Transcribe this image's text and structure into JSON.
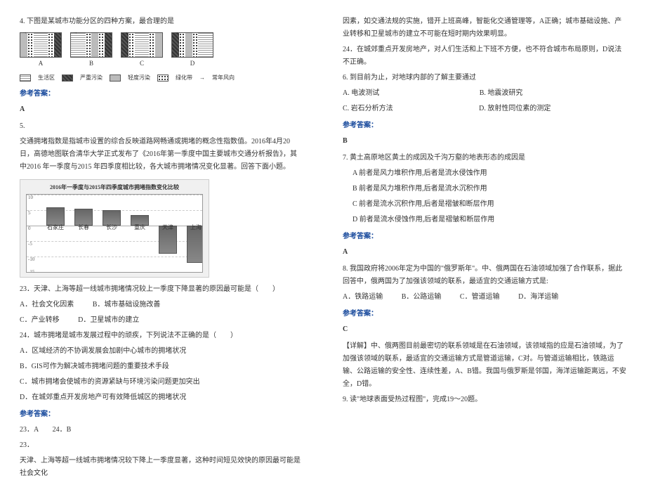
{
  "left": {
    "q4": {
      "prompt": "4. 下图是某城市功能分区的四种方案，最合理的是",
      "diagram_labels": [
        "A",
        "B",
        "C",
        "D"
      ],
      "legend": {
        "life": "生活区",
        "heavy": "严重污染",
        "light": "轻度污染",
        "green": "绿化带",
        "wind_arrow": "→",
        "wind": "常年风向"
      },
      "ans_label": "参考答案：",
      "answer": "A"
    },
    "q5": {
      "num": "5.",
      "context": "交通拥堵指数是指城市设置的综合反映道路网畅通或拥堵的概念性指数值。2016年4月20日，高德地图联合清华大学正式发布了《2016年第一季度中国主要城市交通分析报告》，其中2016 年一季度与2015 年四季度相比较，各大城市拥堵情况变化显著。回答下面小题。",
      "q23": "23．天津、上海等超一线城市拥堵情况较上一季度下降显著的原因最可能是（　　）",
      "q23_opts": {
        "A": "A．社会文化因素",
        "B": "B．城市基础设施改善",
        "C": "C．产业转移",
        "D": "D．卫星城市的建立"
      },
      "q24": "24．城市拥堵是城市发展过程中的顽疾，下列说法不正确的是（　　）",
      "q24_opts": {
        "A": "A．区域经济的不协调发展会加剧中心城市的拥堵状况",
        "B": "B．GIS可作为解决城市拥堵问题的重要技术手段",
        "C": "C．城市拥堵会使城市的资源紧缺与环境污染问题更加突出",
        "D": "D．在城郊重点开发房地产可有效降低城区的拥堵状况"
      },
      "ans_label": "参考答案：",
      "answer_line": "23．A　　24．B",
      "exp_num": "23．",
      "explanation": "天津、上海等超一线城市拥堵情况较下降上一季度显著，这种时间短见效快的原因最可能是社会文化"
    }
  },
  "right": {
    "q5_cont": {
      "line1": "因素，如交通法规的实施，错开上班高峰，智能化交通管理等，A正确；城市基础设施、产业转移和卫星城市的建立不可能在短时期内效果明显。",
      "line2": "24．在城郊重点开发房地产，对人们生活和上下班不方便，也不符合城市布局原则，D说法不正确。"
    },
    "q6": {
      "prompt": "6. 到目前为止，对地球内部的了解主要通过",
      "opts": {
        "A": "A. 电波测试",
        "B": "B. 地震波研究",
        "C": "C. 岩石分析方法",
        "D": "D. 放射性同位素的测定"
      },
      "ans_label": "参考答案：",
      "answer": "B"
    },
    "q7": {
      "prompt": "7. 黄土高原地区黄土的成因及千沟万壑的地表形态的成因是",
      "opts": {
        "A": "A 前者是风力堆积作用,后者是流水侵蚀作用",
        "B": "B 前者是风力堆积作用,后者是流水沉积作用",
        "C": "C 前者是流水沉积作用,后者是褶皱和断层作用",
        "D": "D 前者是流水侵蚀作用,后者是褶皱和断层作用"
      },
      "ans_label": "参考答案：",
      "answer": "A"
    },
    "q8": {
      "prompt": "8. 我国政府将2006年定为中国的\"俄罗斯年\"。中、俄两国在石油领域加强了合作联系，据此回答中，俄两国为了加强该领域的联系，最适宜的交通运输方式是:",
      "opts": {
        "A": "A．铁路运输",
        "B": "B．公路运输",
        "C": "C．管道运输",
        "D": "D．海洋运输"
      },
      "ans_label": "参考答案：",
      "answer": "C",
      "exp": "【详解】中、俄两图目前最密切的联系领域是在石油领域，该领域指的应是石油领域，为了加强该领域的联系，最适宜的交通运输方式是管道运输，C对。与管道运输相比，铁路运输、公路运输的安全性、连续性差，A、B错。我国与俄罗斯是邻国，海洋运输距离远，不安全，D错。"
    },
    "q9": {
      "prompt": "9. 读\"地球表面受热过程图\"，完成19～20题。"
    }
  },
  "chart_data": {
    "type": "bar",
    "title": "2016年一季度与2015年四季度城市拥堵指数变化比较",
    "categories": [
      "石家庄",
      "长春",
      "长沙",
      "重庆",
      "天津",
      "上海"
    ],
    "values": [
      6.0,
      5.5,
      5.0,
      3.5,
      -9.0,
      -12.0
    ],
    "ylabel": "",
    "ylim": [
      -15,
      10
    ],
    "yticks": [
      10.0,
      5.0,
      0.0,
      -5.0,
      -10.0,
      -15.0
    ]
  }
}
